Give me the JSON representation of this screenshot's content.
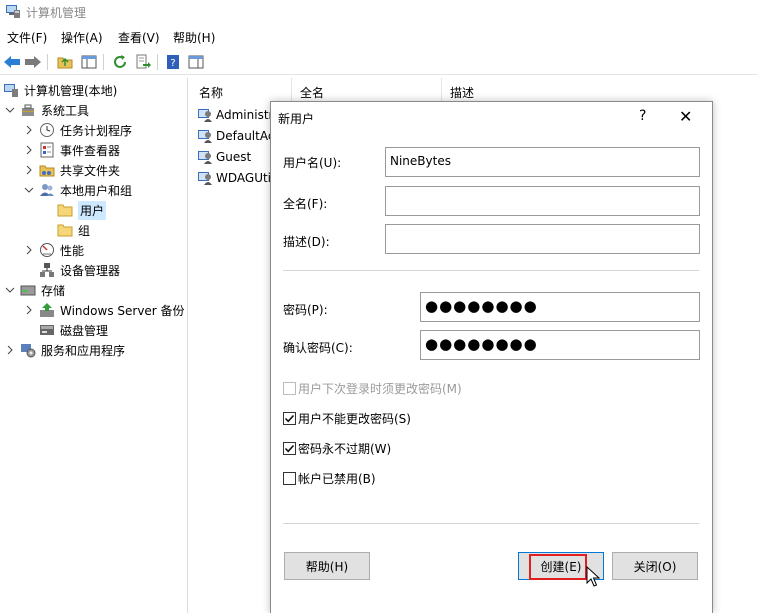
{
  "window": {
    "title": "计算机管理"
  },
  "menu": [
    "文件(F)",
    "操作(A)",
    "查看(V)",
    "帮助(H)"
  ],
  "toolbar": {
    "buttons": [
      "back-icon",
      "forward-icon",
      "up-folder-icon",
      "show-hide-tree-icon",
      "refresh-icon",
      "export-list-icon",
      "help-icon",
      "properties-pane-icon"
    ]
  },
  "tree": {
    "root": "计算机管理(本地)",
    "system_tools": "系统工具",
    "task_scheduler": "任务计划程序",
    "event_viewer": "事件查看器",
    "shared_folders": "共享文件夹",
    "local_users_groups": "本地用户和组",
    "users": "用户",
    "groups": "组",
    "performance": "性能",
    "device_manager": "设备管理器",
    "storage": "存储",
    "windows_server_backup": "Windows Server 备份",
    "disk_management": "磁盘管理",
    "services_apps": "服务和应用程序"
  },
  "list": {
    "columns": [
      "名称",
      "全名",
      "描述"
    ],
    "rows": [
      "Administr",
      "DefaultAc",
      "Guest",
      "WDAGUti"
    ]
  },
  "dialog": {
    "title": "新用户",
    "help": "?",
    "close": "✕",
    "username_label": "用户名(U):",
    "username_value": "NineBytes",
    "fullname_label": "全名(F):",
    "fullname_value": "",
    "description_label": "描述(D):",
    "description_value": "",
    "password_label": "密码(P):",
    "password_value": "●●●●●●●●",
    "confirm_label": "确认密码(C):",
    "confirm_value": "●●●●●●●●",
    "checkboxes": [
      {
        "label": "用户下次登录时须更改密码(M)",
        "checked": false,
        "disabled": true
      },
      {
        "label": "用户不能更改密码(S)",
        "checked": true,
        "disabled": false
      },
      {
        "label": "密码永不过期(W)",
        "checked": true,
        "disabled": false
      },
      {
        "label": "帐户已禁用(B)",
        "checked": false,
        "disabled": false
      }
    ],
    "help_button": "帮助(H)",
    "create_button": "创建(E)",
    "close_button": "关闭(O)"
  },
  "colors": {
    "selection": "#cde8ff",
    "focus_ring": "#e02020",
    "default_button_border": "#0078d7"
  }
}
